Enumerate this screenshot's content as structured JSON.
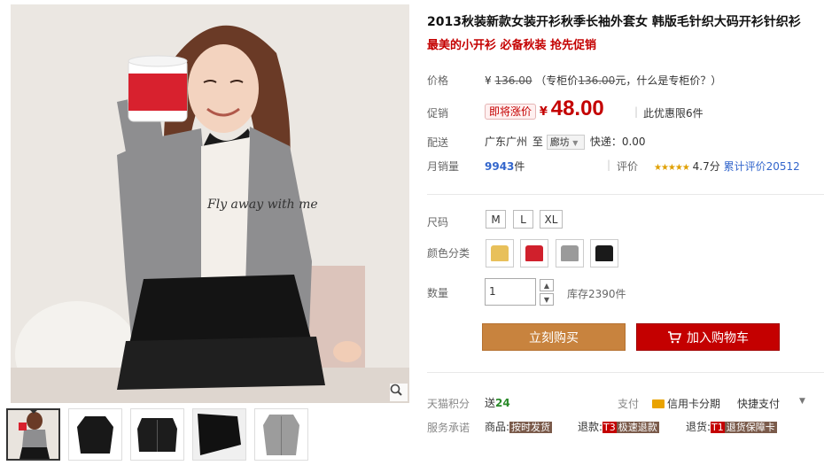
{
  "product": {
    "title": "2013秋装新款女装开衫秋季长袖外套女 韩版毛针织大码开衫针织衫",
    "subtitle": "最美的小开衫 必备秋装 抢先促销"
  },
  "price": {
    "label": "价格",
    "yen": "¥",
    "original": "136.00",
    "note_prefix": "（专柜价",
    "note_price": "136.00",
    "note_suffix": "元，什么是专柜价？）"
  },
  "promo": {
    "label": "促销",
    "tag": "即将涨价",
    "yen": "¥",
    "price": "48.00",
    "limit": "此优惠限6件"
  },
  "shipping": {
    "label": "配送",
    "from": "广东广州",
    "to_word": "至",
    "destination": "廊坊",
    "express": "快递：0.00"
  },
  "sales": {
    "label": "月销量",
    "count": "9943",
    "unit": "件",
    "rating_label": "评价",
    "stars": "★★★★★",
    "score": "4.7分",
    "total_reviews": "累计评价20512"
  },
  "sizes": {
    "label": "尺码",
    "options": [
      "M",
      "L",
      "XL"
    ]
  },
  "colors": {
    "label": "颜色分类",
    "swatches": [
      {
        "name": "yellow",
        "hex": "#e8c05a"
      },
      {
        "name": "red",
        "hex": "#d0202c"
      },
      {
        "name": "gray",
        "hex": "#9a9a9a"
      },
      {
        "name": "black",
        "hex": "#1a1a1a"
      }
    ]
  },
  "quantity": {
    "label": "数量",
    "value": "1",
    "stock": "库存2390件"
  },
  "buttons": {
    "buy_now": "立刻购买",
    "add_cart": "加入购物车"
  },
  "points": {
    "label": "天猫积分",
    "prefix": "送",
    "value": "24",
    "pay_label": "支付",
    "credit": "信用卡分期",
    "quick_pay": "快捷支付"
  },
  "service": {
    "label": "服务承诺",
    "goods_label": "商品:",
    "goods_tag": "按时发货",
    "refund_label": "退款:",
    "refund_code": "T3",
    "refund_tag": "极速退款",
    "return_label": "退货:",
    "return_code": "T1",
    "return_tag": "退货保障卡"
  },
  "image_text": {
    "shirt_print": "Fly away with me"
  }
}
